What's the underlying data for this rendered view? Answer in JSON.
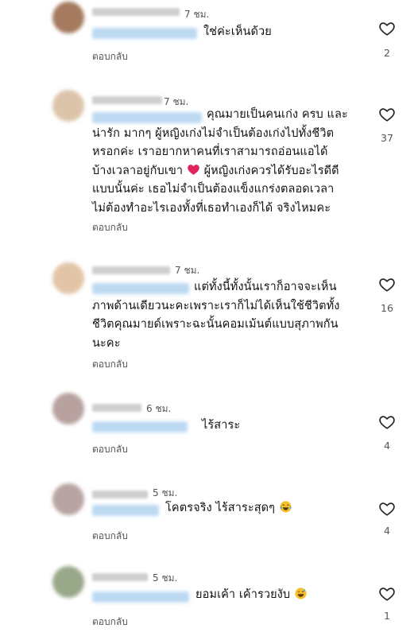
{
  "comments": [
    {
      "time": "7 ชม.",
      "lines": [
        "ใช่ค่ะเห็นด้วย"
      ],
      "reply": "ตอบกลับ",
      "likes": "2"
    },
    {
      "time": "7 ชม.",
      "lines": [
        "คุณมายเป็นคนเก่ง ครบ และ",
        "น่ารัก มากๆ ผู้หญิงเก่งไม่จำเป็นต้องเก่งไปทั้งชีวิต",
        "หรอกค่ะ เราอยากหาคนที่เราสามารถอ่อนแอได้",
        "บ้างเวลาอยู่กับเขา",
        "แบบนั้นค่ะ  เธอไม่จำเป็นต้องแข็งแกร่งตลอดเวลา",
        "ไม่ต้องทำอะไรเองทั้งที่เธอทำเองก็ได้  จริงไหมคะ"
      ],
      "line4_after": " ผู้หญิงเก่งควรได้รับอะไรดีดี",
      "reply": "ตอบกลับ",
      "likes": "37"
    },
    {
      "time": "7 ชม.",
      "lines": [
        "แต่ทั้งนี้ทั้งนั้นเราก็อาจจะเห็น",
        "ภาพด้านเดียวนะคะเพราะเราก็ไม่ได้เห็นใช้ชีวิตทั้ง",
        "ชีวิตคุณมายด์เพราะฉะนั้นคอมเม้นต์แบบสุภาพกัน",
        "นะคะ"
      ],
      "reply": "ตอบกลับ",
      "likes": "16"
    },
    {
      "time": "6 ชม.",
      "lines": [
        "ไร้สาระ"
      ],
      "reply": "ตอบกลับ",
      "likes": "4"
    },
    {
      "time": "5 ชม.",
      "lines": [
        "โคตรจริง ไร้สาระสุดๆ"
      ],
      "reply": "ตอบกลับ",
      "likes": "4"
    },
    {
      "time": "5 ชม.",
      "lines": [
        "ยอมเค้า เค้ารวยงับ"
      ],
      "reply": "ตอบกลับ",
      "likes": "1"
    }
  ],
  "icons": {
    "heart": "heart-outline-icon",
    "emoji_heart": "red-heart-emoji",
    "emoji_laugh": "tears-of-joy-emoji",
    "emoji_sweat": "grinning-sweat-emoji"
  },
  "colors": {
    "mention": "#bcd9f2",
    "heart_emoji": "#e0245e",
    "emoji_yellow": "#f7c02b"
  }
}
